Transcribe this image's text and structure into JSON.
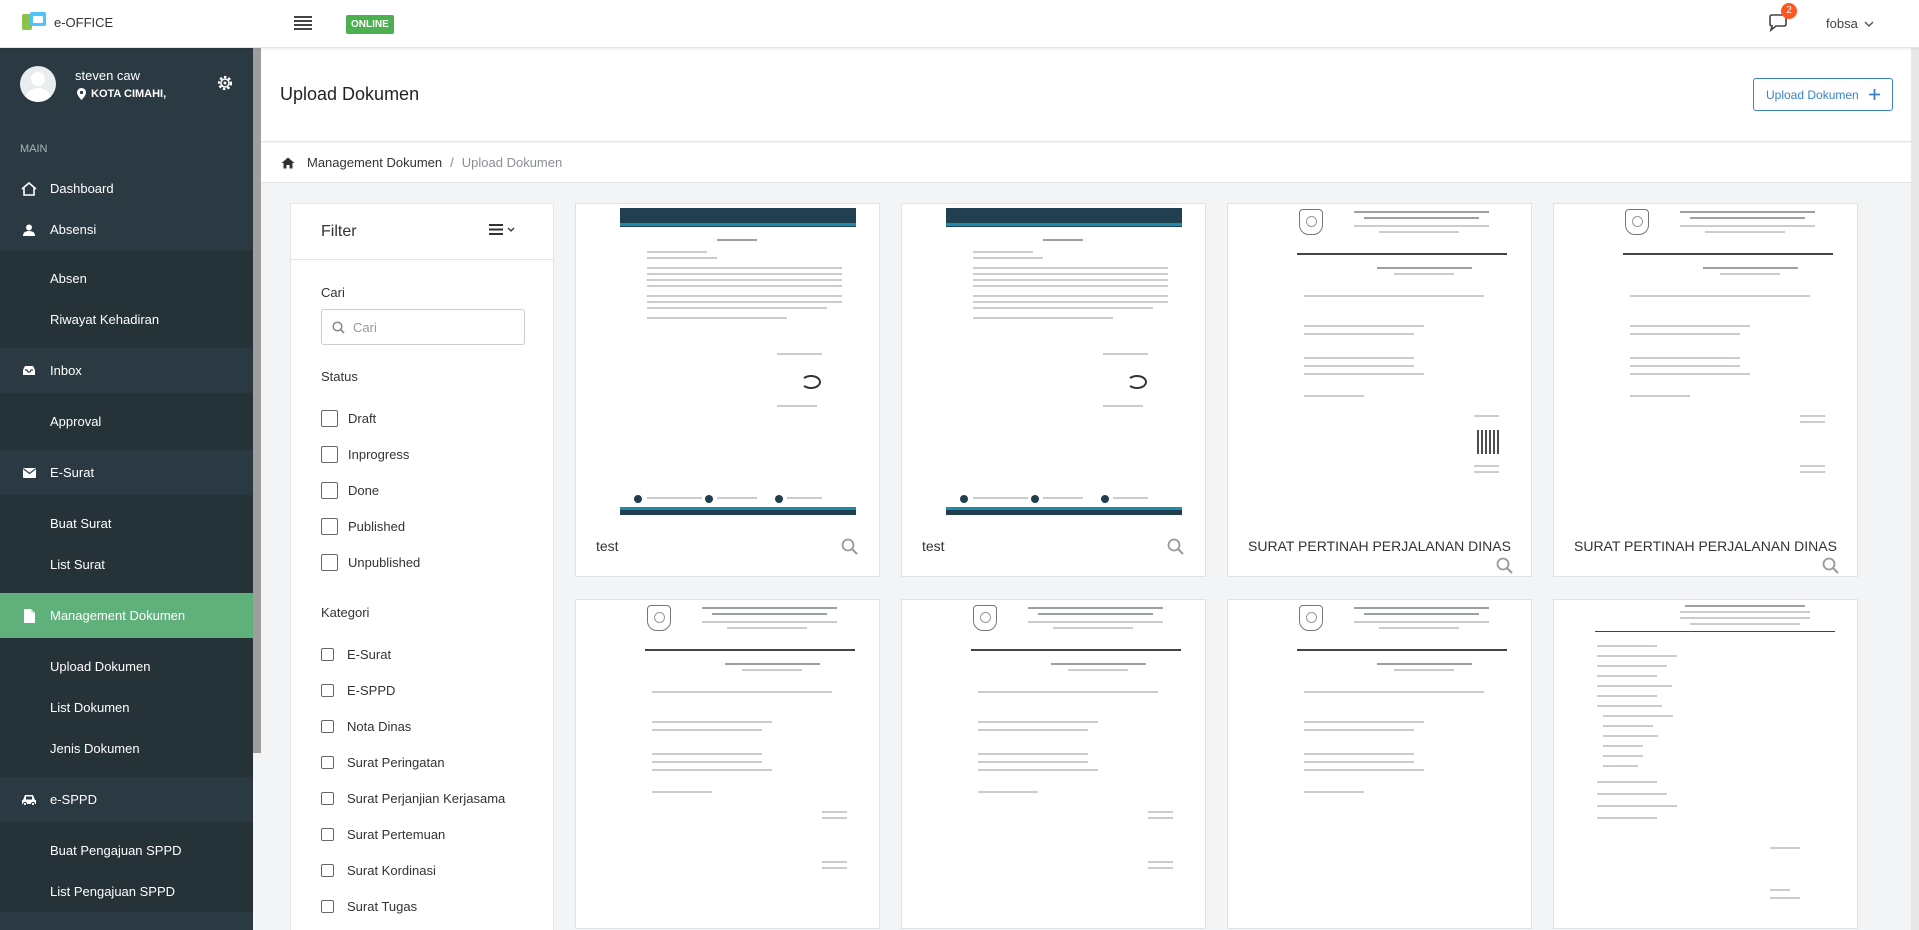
{
  "app": {
    "name": "e-OFFICE",
    "status_badge": "ONLINE",
    "notification_count": "2",
    "user": "fobsa"
  },
  "profile": {
    "name": "steven caw",
    "location": "KOTA CIMAHI,"
  },
  "sidebar": {
    "section": "MAIN",
    "items": [
      {
        "label": "Dashboard",
        "icon": "home-icon"
      },
      {
        "label": "Absensi",
        "icon": "user-icon"
      },
      {
        "label": "Absen"
      },
      {
        "label": "Riwayat Kehadiran"
      },
      {
        "label": "Inbox",
        "icon": "inbox-icon"
      },
      {
        "label": "Approval"
      },
      {
        "label": "E-Surat",
        "icon": "envelope-icon"
      },
      {
        "label": "Buat Surat"
      },
      {
        "label": "List Surat"
      },
      {
        "label": "Management Dokumen",
        "icon": "file-icon"
      },
      {
        "label": "Upload Dokumen"
      },
      {
        "label": "List Dokumen"
      },
      {
        "label": "Jenis Dokumen"
      },
      {
        "label": "e-SPPD",
        "icon": "car-icon"
      },
      {
        "label": "Buat Pengajuan SPPD"
      },
      {
        "label": "List Pengajuan SPPD"
      }
    ]
  },
  "page": {
    "title": "Upload Dokumen",
    "upload_button": "Upload Dokumen"
  },
  "breadcrumb": {
    "root": "Management Dokumen",
    "separator": "/",
    "current": "Upload Dokumen"
  },
  "filter": {
    "title": "Filter",
    "search_label": "Cari",
    "search_placeholder": "Cari",
    "status_label": "Status",
    "statuses": [
      "Draft",
      "Inprogress",
      "Done",
      "Published",
      "Unpublished"
    ],
    "category_label": "Kategori",
    "categories": [
      "E-Surat",
      "E-SPPD",
      "Nota Dinas",
      "Surat Peringatan",
      "Surat Perjanjian Kerjasama",
      "Surat Pertemuan",
      "Surat Kordinasi",
      "Surat Tugas"
    ]
  },
  "documents": [
    {
      "title": "test"
    },
    {
      "title": "test"
    },
    {
      "title": "SURAT PERTINAH PERJALANAN DINAS"
    },
    {
      "title": "SURAT PERTINAH PERJALANAN DINAS"
    }
  ]
}
